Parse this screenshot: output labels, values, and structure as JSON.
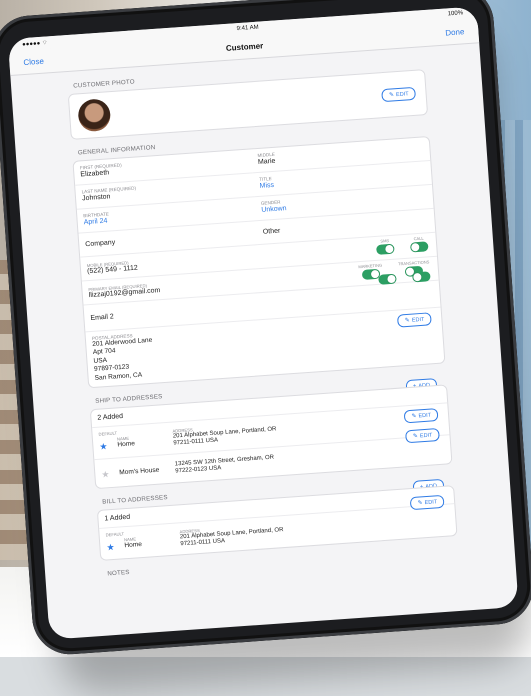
{
  "status": {
    "carrier": "●●●●● ⌔",
    "time": "9:41 AM",
    "battery": "100%"
  },
  "nav": {
    "close": "Close",
    "title": "Customer",
    "done": "Done"
  },
  "edit_label": "EDIT",
  "add_label": "ADD",
  "photo": {
    "section": "CUSTOMER PHOTO"
  },
  "general": {
    "section": "GENERAL INFORMATION",
    "first_label": "FIRST (REQUIRED)",
    "first": "Elizabeth",
    "middle_label": "MIDDLE",
    "middle": "Marie",
    "last_label": "LAST NAME (REQUIRED)",
    "last": "Johnston",
    "title_label": "TITLE",
    "title": "Miss",
    "birthdate_label": "BIRTHDATE",
    "birthdate": "April 24",
    "gender_label": "GENDER",
    "gender": "Unkown",
    "company": "Company",
    "other": "Other",
    "mobile_label": "MOBILE (REQUIRED)",
    "mobile": "(522) 549 - 1112",
    "sms_label": "SMS",
    "call_label": "CALL",
    "email_label": "PRIMARY EMAIL (REQUIRED)",
    "email": "llizzaj0192@gmail.com",
    "marketing_label": "MARKETING",
    "transactions_label": "TRANSACTIONS",
    "email2": "Email 2",
    "postal_label": "POSTAL ADDRESS",
    "postal": [
      "201 Alderwood Lane",
      "Apt 704",
      "USA",
      "97897-0123",
      "San Ramon, CA"
    ]
  },
  "ship": {
    "section": "SHIP TO ADDRESSES",
    "count": "2 Added",
    "default_label": "DEFAULT",
    "name_label": "NAME",
    "address_label": "ADDRESS",
    "rows": [
      {
        "name": "Home",
        "line1": "201 Alphabet Soup Lane, Portland, OR",
        "line2": "97211-0111  USA"
      },
      {
        "name": "Mom's House",
        "line1": "13245 SW 12th Street, Gresham, OR",
        "line2": "97222-0123  USA"
      }
    ]
  },
  "bill": {
    "section": "BILL TO ADDRESSES",
    "count": "1 Added",
    "default_label": "DEFAULT",
    "name_label": "NAME",
    "address_label": "ADDRESS",
    "rows": [
      {
        "name": "Home",
        "line1": "201 Alphabet Soup Lane, Portland, OR",
        "line2": "97211-0111  USA"
      }
    ]
  },
  "notes": {
    "section": "NOTES"
  }
}
